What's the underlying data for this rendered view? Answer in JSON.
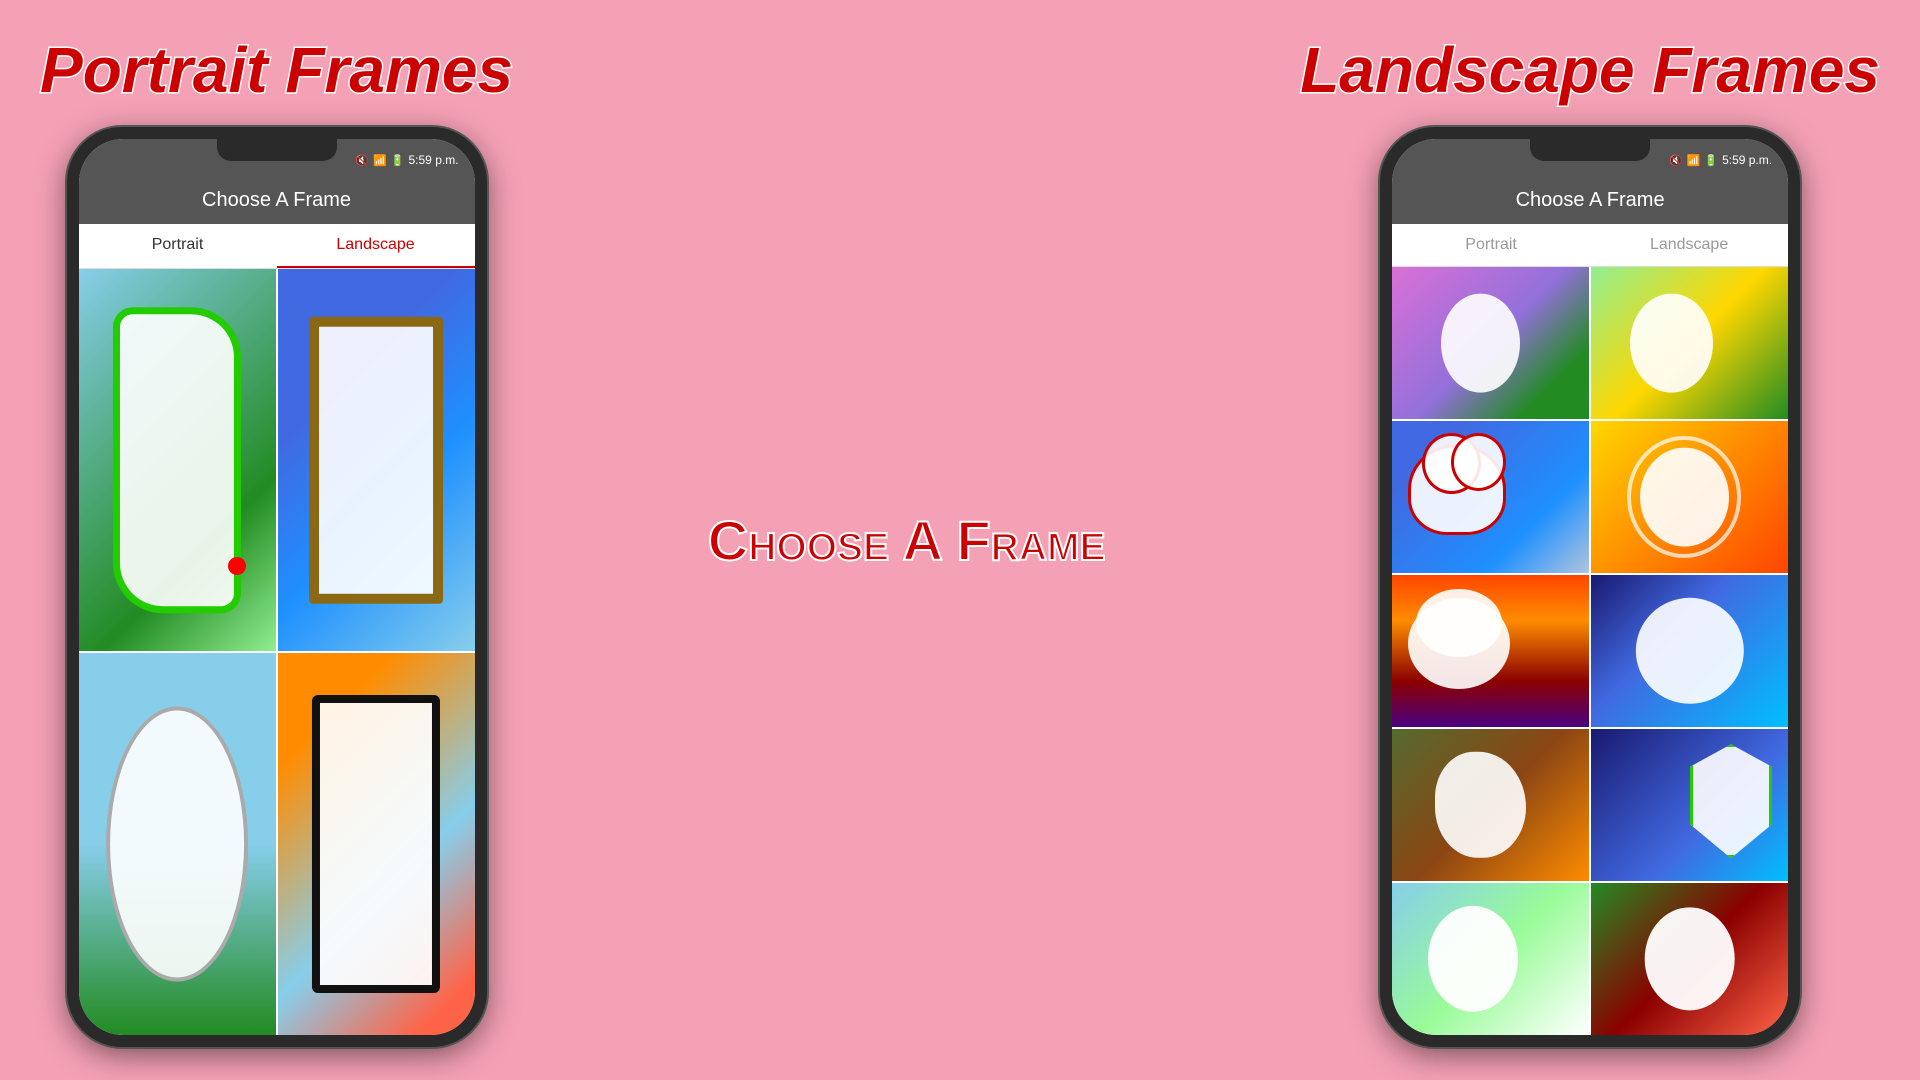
{
  "page": {
    "background_color": "#f4a0b5"
  },
  "portrait_section": {
    "title": "Portrait Frames",
    "phone": {
      "status_bar": {
        "time": "5:59 p.m.",
        "signal": "1",
        "battery": "6%"
      },
      "app_header": "Choose A Frame",
      "tabs": [
        {
          "label": "Portrait",
          "active": false
        },
        {
          "label": "Landscape",
          "active": true
        }
      ],
      "frames": [
        {
          "id": 1,
          "bg": "portrait-bg-1",
          "frame_type": "green-ornate"
        },
        {
          "id": 2,
          "bg": "portrait-bg-2",
          "frame_type": "bamboo"
        },
        {
          "id": 3,
          "bg": "portrait-bg-3",
          "frame_type": "circle-floral"
        },
        {
          "id": 4,
          "bg": "portrait-bg-4",
          "frame_type": "black-ornate"
        }
      ]
    }
  },
  "center_section": {
    "title": "Choose A Frame"
  },
  "landscape_section": {
    "title": "Landscape Frames",
    "phone": {
      "status_bar": {
        "time": "5:59 p.m.",
        "signal": "1",
        "battery": "6%"
      },
      "app_header": "Choose A Frame",
      "tabs": [
        {
          "label": "Portrait",
          "active": false
        },
        {
          "label": "Landscape",
          "active": false
        }
      ],
      "frames": [
        {
          "id": 1,
          "bg": "landscape-bg-1",
          "frame_type": "oval-left"
        },
        {
          "id": 2,
          "bg": "landscape-bg-2",
          "frame_type": "oval-right"
        },
        {
          "id": 3,
          "bg": "landscape-bg-3",
          "frame_type": "cloud"
        },
        {
          "id": 4,
          "bg": "landscape-bg-4",
          "frame_type": "flower"
        },
        {
          "id": 5,
          "bg": "landscape-bg-5",
          "frame_type": "speech"
        },
        {
          "id": 6,
          "bg": "landscape-bg-6",
          "frame_type": "oval"
        },
        {
          "id": 7,
          "bg": "landscape-bg-7",
          "frame_type": "flower2"
        },
        {
          "id": 8,
          "bg": "landscape-bg-8",
          "frame_type": "shield"
        },
        {
          "id": 9,
          "bg": "landscape-bg-9",
          "frame_type": "oval2"
        },
        {
          "id": 10,
          "bg": "landscape-bg-10",
          "frame_type": "circle2"
        }
      ]
    }
  }
}
